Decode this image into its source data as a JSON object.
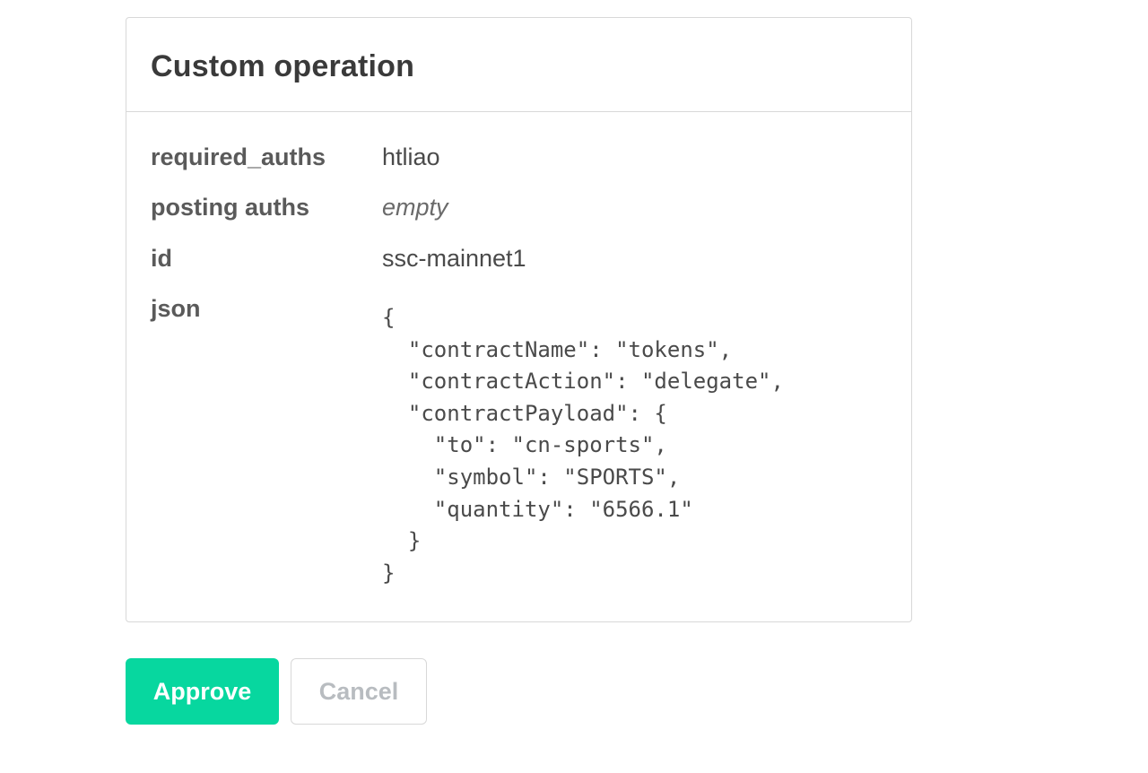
{
  "card": {
    "title": "Custom operation",
    "fields": [
      {
        "label": "required_auths",
        "value": "htliao"
      },
      {
        "label": "posting auths",
        "value": "empty"
      },
      {
        "label": "id",
        "value": "ssc-mainnet1"
      },
      {
        "label": "json",
        "value": "{\n  \"contractName\": \"tokens\",\n  \"contractAction\": \"delegate\",\n  \"contractPayload\": {\n    \"to\": \"cn-sports\",\n    \"symbol\": \"SPORTS\",\n    \"quantity\": \"6566.1\"\n  }\n}"
      }
    ]
  },
  "actions": {
    "approve_label": "Approve",
    "cancel_label": "Cancel"
  },
  "colors": {
    "approve_bg": "#07d79f",
    "text": "#3a3a3a",
    "border": "#d8d8d8",
    "cancel_text": "#b8bcc0"
  }
}
